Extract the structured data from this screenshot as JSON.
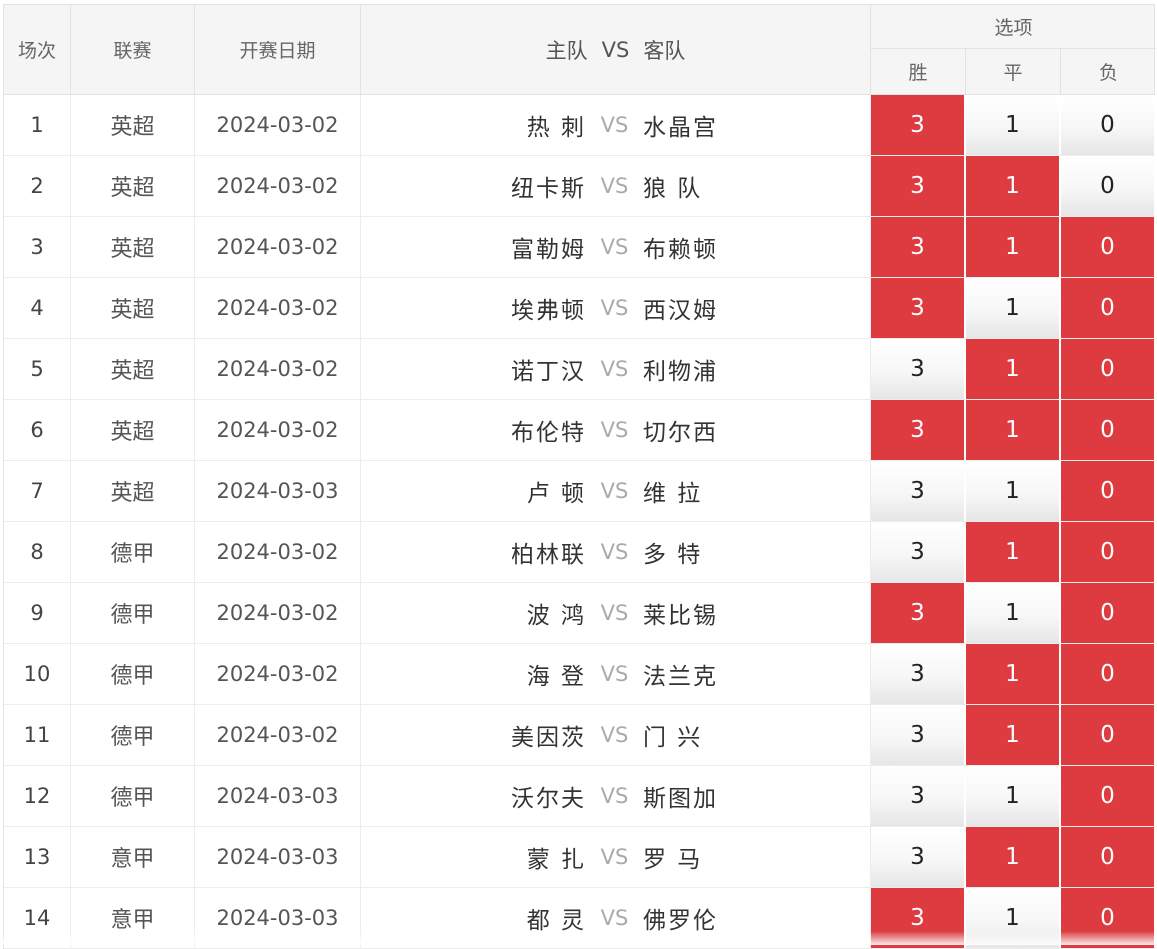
{
  "header": {
    "no": "场次",
    "league": "联赛",
    "date": "开赛日期",
    "home": "主队",
    "vs": "VS",
    "away": "客队",
    "options_title": "选项",
    "win": "胜",
    "draw": "平",
    "lose": "负"
  },
  "colors": {
    "selected": "#dd3b3f",
    "header_bg": "#f5f5f5"
  },
  "rows": [
    {
      "no": "1",
      "league": "英超",
      "date": "2024-03-02",
      "home": "热 刺",
      "vs": "VS",
      "away": "水晶宫",
      "opts": [
        "3",
        "1",
        "0"
      ],
      "sel": [
        true,
        false,
        false
      ]
    },
    {
      "no": "2",
      "league": "英超",
      "date": "2024-03-02",
      "home": "纽卡斯",
      "vs": "VS",
      "away": "狼 队",
      "opts": [
        "3",
        "1",
        "0"
      ],
      "sel": [
        true,
        true,
        false
      ]
    },
    {
      "no": "3",
      "league": "英超",
      "date": "2024-03-02",
      "home": "富勒姆",
      "vs": "VS",
      "away": "布赖顿",
      "opts": [
        "3",
        "1",
        "0"
      ],
      "sel": [
        true,
        true,
        true
      ]
    },
    {
      "no": "4",
      "league": "英超",
      "date": "2024-03-02",
      "home": "埃弗顿",
      "vs": "VS",
      "away": "西汉姆",
      "opts": [
        "3",
        "1",
        "0"
      ],
      "sel": [
        true,
        false,
        true
      ]
    },
    {
      "no": "5",
      "league": "英超",
      "date": "2024-03-02",
      "home": "诺丁汉",
      "vs": "VS",
      "away": "利物浦",
      "opts": [
        "3",
        "1",
        "0"
      ],
      "sel": [
        false,
        true,
        true
      ]
    },
    {
      "no": "6",
      "league": "英超",
      "date": "2024-03-02",
      "home": "布伦特",
      "vs": "VS",
      "away": "切尔西",
      "opts": [
        "3",
        "1",
        "0"
      ],
      "sel": [
        true,
        true,
        true
      ]
    },
    {
      "no": "7",
      "league": "英超",
      "date": "2024-03-03",
      "home": "卢 顿",
      "vs": "VS",
      "away": "维 拉",
      "opts": [
        "3",
        "1",
        "0"
      ],
      "sel": [
        false,
        false,
        true
      ]
    },
    {
      "no": "8",
      "league": "德甲",
      "date": "2024-03-02",
      "home": "柏林联",
      "vs": "VS",
      "away": "多 特",
      "opts": [
        "3",
        "1",
        "0"
      ],
      "sel": [
        false,
        true,
        true
      ]
    },
    {
      "no": "9",
      "league": "德甲",
      "date": "2024-03-02",
      "home": "波 鸿",
      "vs": "VS",
      "away": "莱比锡",
      "opts": [
        "3",
        "1",
        "0"
      ],
      "sel": [
        true,
        false,
        true
      ]
    },
    {
      "no": "10",
      "league": "德甲",
      "date": "2024-03-02",
      "home": "海 登",
      "vs": "VS",
      "away": "法兰克",
      "opts": [
        "3",
        "1",
        "0"
      ],
      "sel": [
        false,
        true,
        true
      ]
    },
    {
      "no": "11",
      "league": "德甲",
      "date": "2024-03-02",
      "home": "美因茨",
      "vs": "VS",
      "away": "门 兴",
      "opts": [
        "3",
        "1",
        "0"
      ],
      "sel": [
        false,
        true,
        true
      ]
    },
    {
      "no": "12",
      "league": "德甲",
      "date": "2024-03-03",
      "home": "沃尔夫",
      "vs": "VS",
      "away": "斯图加",
      "opts": [
        "3",
        "1",
        "0"
      ],
      "sel": [
        false,
        false,
        true
      ]
    },
    {
      "no": "13",
      "league": "意甲",
      "date": "2024-03-03",
      "home": "蒙 扎",
      "vs": "VS",
      "away": "罗 马",
      "opts": [
        "3",
        "1",
        "0"
      ],
      "sel": [
        false,
        true,
        true
      ]
    },
    {
      "no": "14",
      "league": "意甲",
      "date": "2024-03-03",
      "home": "都 灵",
      "vs": "VS",
      "away": "佛罗伦",
      "opts": [
        "3",
        "1",
        "0"
      ],
      "sel": [
        true,
        false,
        true
      ]
    }
  ]
}
